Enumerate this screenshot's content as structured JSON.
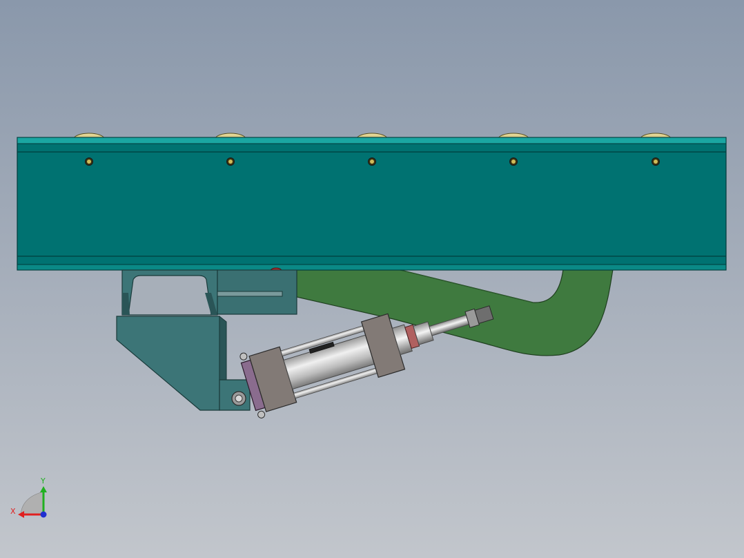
{
  "viewport": {
    "background_top": "#8a98ab",
    "background_bottom": "#c2c6cc"
  },
  "colors": {
    "conveyor_body": "#007271",
    "conveyor_edge": "#27a8a4",
    "conveyor_line": "#004b4a",
    "roller": "#c9b86a",
    "bolt": "#b7a24a",
    "bracket": "#3c7577",
    "bracket_dark": "#2a5557",
    "green_arm": "#3f7a3f",
    "green_arm_dark": "#2c5a2c",
    "cylinder_block": "#827a76",
    "cylinder_tube": "#d2d2d2",
    "cylinder_end_purple": "#8a6c8e"
  },
  "triad": {
    "x_label": "X",
    "y_label": "Y",
    "x_color": "#e02020",
    "y_color": "#20b020",
    "z_color": "#2030d0"
  }
}
